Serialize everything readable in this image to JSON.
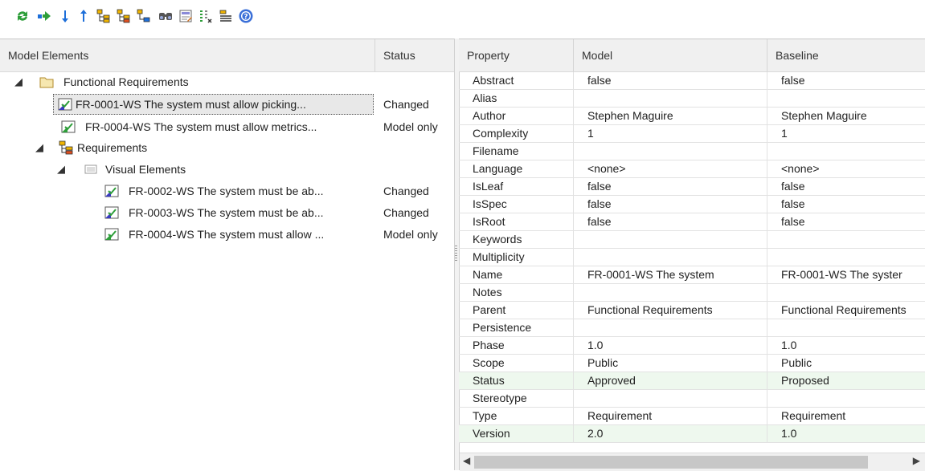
{
  "toolbar": {
    "buttons": [
      "refresh-icon",
      "restore-icon",
      "next-difference-icon",
      "previous-difference-icon",
      "expand-all-icon",
      "collapse-all-icon",
      "show-all-icon",
      "find-icon",
      "xml-options-icon",
      "filter-icon",
      "properties-icon",
      "help-icon"
    ]
  },
  "tree": {
    "headers": {
      "elements": "Model Elements",
      "status": "Status"
    },
    "items": [
      {
        "label": "Functional Requirements",
        "status": "",
        "icon": "folder-icon",
        "expander": "◢"
      },
      {
        "label": "FR-0001-WS The system must allow picking...",
        "status": "Changed",
        "icon": "requirement-changed-icon",
        "expander": ""
      },
      {
        "label": "FR-0004-WS The system must allow metrics...",
        "status": "Model only",
        "icon": "requirement-model-only-icon",
        "expander": ""
      },
      {
        "label": "Requirements",
        "status": "",
        "icon": "package-diagram-icon",
        "expander": "◢"
      },
      {
        "label": "Visual Elements",
        "status": "",
        "icon": "boundary-icon",
        "expander": "◢"
      },
      {
        "label": "FR-0002-WS The system must be ab...",
        "status": "Changed",
        "icon": "requirement-changed-icon",
        "expander": ""
      },
      {
        "label": "FR-0003-WS The system must be ab...",
        "status": "Changed",
        "icon": "requirement-changed-icon",
        "expander": ""
      },
      {
        "label": "FR-0004-WS The system must allow ...",
        "status": "Model only",
        "icon": "requirement-model-only-icon",
        "expander": ""
      }
    ]
  },
  "grid": {
    "headers": {
      "property": "Property",
      "model": "Model",
      "baseline": "Baseline"
    },
    "rows": [
      {
        "property": "Abstract",
        "model": "false",
        "baseline": "false",
        "diff": false
      },
      {
        "property": "Alias",
        "model": "",
        "baseline": "",
        "diff": false
      },
      {
        "property": "Author",
        "model": "Stephen Maguire",
        "baseline": "Stephen Maguire",
        "diff": false
      },
      {
        "property": "Complexity",
        "model": "1",
        "baseline": "1",
        "diff": false
      },
      {
        "property": "Filename",
        "model": "",
        "baseline": "",
        "diff": false
      },
      {
        "property": "Language",
        "model": "<none>",
        "baseline": "<none>",
        "diff": false
      },
      {
        "property": "IsLeaf",
        "model": "false",
        "baseline": "false",
        "diff": false
      },
      {
        "property": "IsSpec",
        "model": "false",
        "baseline": "false",
        "diff": false
      },
      {
        "property": "IsRoot",
        "model": "false",
        "baseline": "false",
        "diff": false
      },
      {
        "property": "Keywords",
        "model": "",
        "baseline": "",
        "diff": false
      },
      {
        "property": "Multiplicity",
        "model": "",
        "baseline": "",
        "diff": false
      },
      {
        "property": "Name",
        "model": "FR-0001-WS The system",
        "baseline": "FR-0001-WS The syster",
        "diff": false
      },
      {
        "property": "Notes",
        "model": "",
        "baseline": "",
        "diff": false
      },
      {
        "property": "Parent",
        "model": "Functional Requirements",
        "baseline": "Functional Requirements",
        "diff": false
      },
      {
        "property": "Persistence",
        "model": "",
        "baseline": "",
        "diff": false
      },
      {
        "property": "Phase",
        "model": "1.0",
        "baseline": "1.0",
        "diff": false
      },
      {
        "property": "Scope",
        "model": "Public",
        "baseline": "Public",
        "diff": false
      },
      {
        "property": "Status",
        "model": "Approved",
        "baseline": "Proposed",
        "diff": true
      },
      {
        "property": "Stereotype",
        "model": "",
        "baseline": "",
        "diff": false
      },
      {
        "property": "Type",
        "model": "Requirement",
        "baseline": "Requirement",
        "diff": false
      },
      {
        "property": "Version",
        "model": "2.0",
        "baseline": "1.0",
        "diff": true
      }
    ]
  },
  "colors": {
    "diff_row": "#eef8ee",
    "header_bg": "#f0f0f0",
    "accent": "#1e6fd9"
  }
}
